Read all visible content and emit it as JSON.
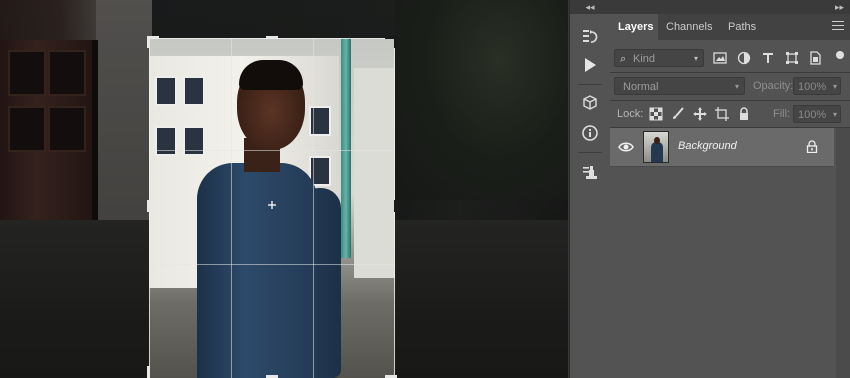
{
  "panel_header": {
    "collapse_left": "◂◂",
    "collapse_right": "▸▸"
  },
  "tabs": [
    {
      "label": "Layers",
      "active": true
    },
    {
      "label": "Channels",
      "active": false
    },
    {
      "label": "Paths",
      "active": false
    }
  ],
  "filter": {
    "kind_label": "Kind",
    "icons": [
      "image-filter-icon",
      "adjustment-filter-icon",
      "type-filter-icon",
      "shape-filter-icon",
      "smart-object-filter-icon"
    ]
  },
  "blend": {
    "mode": "Normal",
    "opacity_label": "Opacity:",
    "opacity_value": "100%"
  },
  "lock": {
    "label": "Lock:",
    "fill_label": "Fill:",
    "fill_value": "100%",
    "icons": [
      "lock-transparent-icon",
      "lock-image-icon",
      "lock-position-icon",
      "lock-artboard-icon",
      "lock-all-icon"
    ]
  },
  "layers": [
    {
      "name": "Background",
      "visible": true,
      "locked": true
    }
  ],
  "tools": [
    "history-icon",
    "play-icon",
    "3d-icon",
    "info-icon",
    "properties-icon"
  ],
  "colors": {
    "panel_bg": "#535353",
    "tab_bar": "#424242",
    "selected_layer": "#6a6a6a"
  }
}
